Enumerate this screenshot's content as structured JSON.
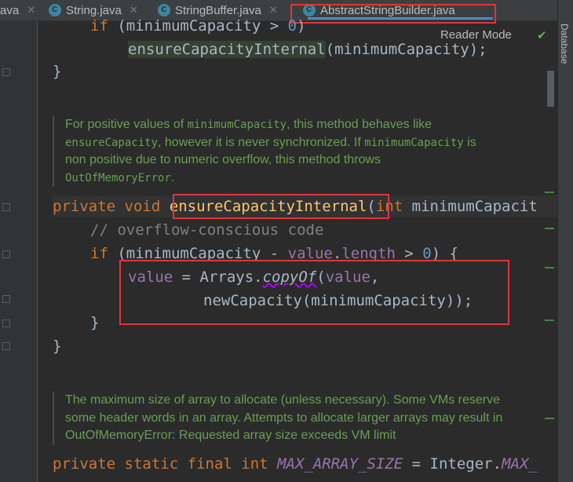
{
  "tabs": [
    {
      "label": "ava",
      "close": "✕"
    },
    {
      "label": "String.java",
      "close": "✕"
    },
    {
      "label": "StringBuffer.java",
      "close": "✕"
    },
    {
      "label": "AbstractStringBuilder.java",
      "close": ""
    }
  ],
  "reader_mode": "Reader Mode",
  "side_panel": "Database",
  "code": {
    "line1": {
      "kw": "if",
      "a": " (minimumCapacity > ",
      "num": "0",
      "b": ")"
    },
    "line2": {
      "method": "ensureCapacityInternal",
      "args": "(minimumCapacity);"
    },
    "line3": "}",
    "doc1": {
      "l1_a": "For positive values of ",
      "l1_code": "minimumCapacity",
      "l1_b": ", this method behaves like",
      "l2_code": "ensureCapacity",
      "l2_a": ", however it is never synchronized. If ",
      "l2_code2": "minimumCapacity",
      "l2_b": " is",
      "l3": "non positive due to numeric overflow, this method throws",
      "l4_code": "OutOfMemoryError",
      "l4_b": "."
    },
    "decl": {
      "kw1": "private",
      "kw2": "void",
      "method": "ensureCapacityInternal",
      "paren": "(",
      "kw3": "int",
      "param": " minimumCapacit"
    },
    "comment": "// overflow-conscious code",
    "ifline": {
      "kw": "if",
      "a": " (minimumCapacity - ",
      "field1": "value",
      "dot": ".",
      "field2": "length",
      "b": " > ",
      "num": "0",
      "c": ") {"
    },
    "assign": {
      "field": "value",
      "a": " = Arrays.",
      "static_method": "copyOf",
      "b": "(",
      "field2": "value",
      "c": ","
    },
    "newcap": "newCapacity(minimumCapacity));",
    "close1": "}",
    "close2": "}",
    "doc2": {
      "l1": "The maximum size of array to allocate (unless necessary). Some VMs reserve",
      "l2": "some header words in an array. Attempts to allocate larger arrays may result in",
      "l3": "OutOfMemoryError: Requested array size exceeds VM limit"
    },
    "last": {
      "kw1": "private",
      "kw2": "static",
      "kw3": "final",
      "kw4": "int",
      "const": "MAX_ARRAY_SIZE",
      "a": " = Integer.",
      "const2": "MAX_"
    }
  },
  "colors": {
    "highlight_box": "#e0353b",
    "keyword": "#cc7832",
    "doc_text": "#6a9e54",
    "field": "#9876aa",
    "number": "#6897bb"
  }
}
